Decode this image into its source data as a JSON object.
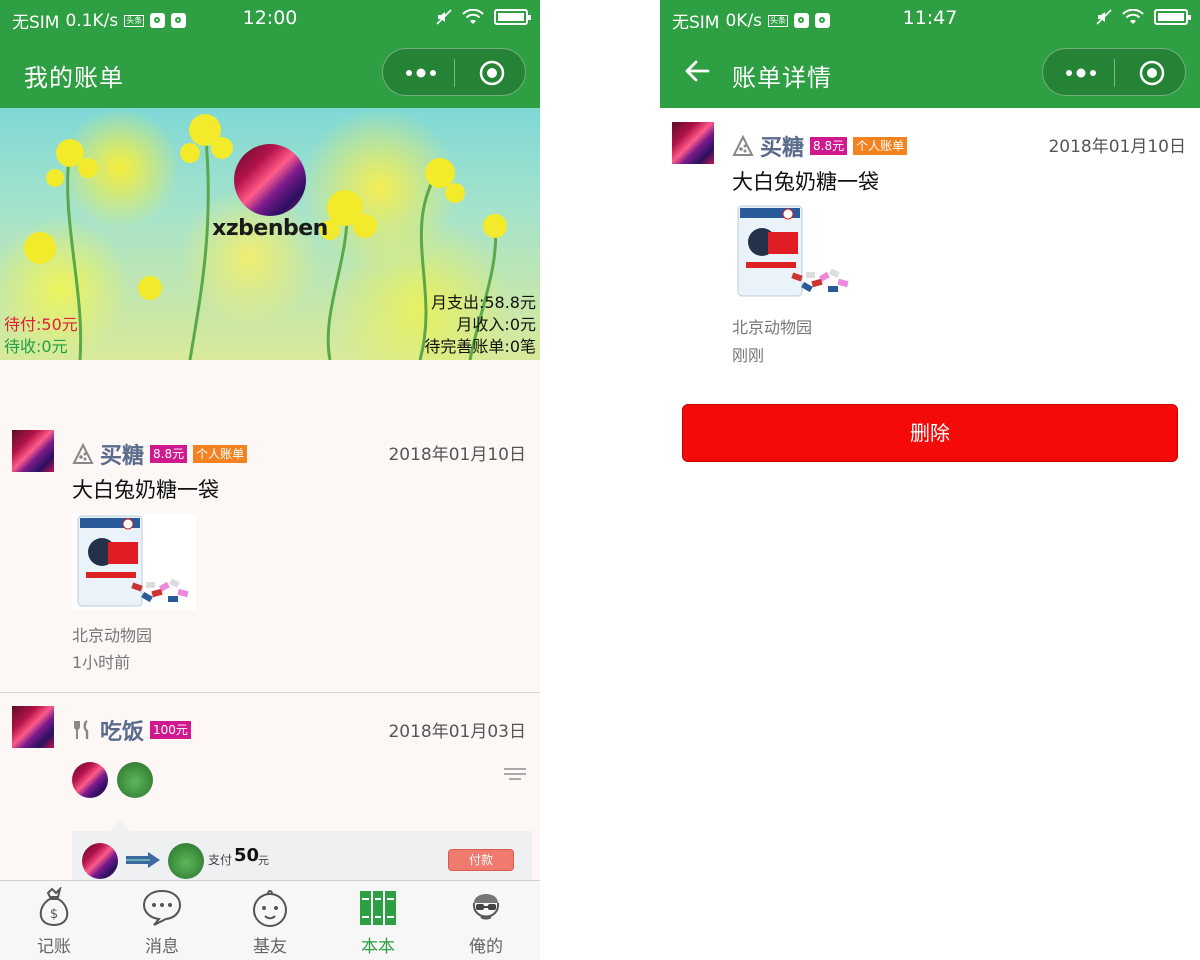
{
  "left": {
    "status": {
      "carrier": "无SIM",
      "speed": "0.1K/s",
      "mini_badge": "头条",
      "time": "12:00"
    },
    "nav": {
      "title": "我的账单"
    },
    "banner": {
      "username": "xzbenben",
      "pending_pay": "待付:50元",
      "pending_receive": "待收:0元",
      "monthly_expense": "月支出:58.8元",
      "monthly_income": "月收入:0元",
      "incomplete_bills": "待完善账单:0笔"
    },
    "bills": [
      {
        "category_icon": "pizza-slice-icon",
        "category": "买糖",
        "amount_tag": "8.8元",
        "type_tag": "个人账单",
        "date": "2018年01月10日",
        "description": "大白兔奶糖一袋",
        "location": "北京动物园",
        "time_ago": "1小时前"
      },
      {
        "category_icon": "fork-knife-icon",
        "category": "吃饭",
        "amount_tag": "100元",
        "date": "2018年01月03日",
        "payment": {
          "label": "支付",
          "amount": "50",
          "unit": "元",
          "button": "付款"
        }
      }
    ],
    "tabs": [
      {
        "label": "记账",
        "icon": "money-bag-icon",
        "active": false
      },
      {
        "label": "消息",
        "icon": "chat-bubble-icon",
        "active": false
      },
      {
        "label": "基友",
        "icon": "baby-face-icon",
        "active": false
      },
      {
        "label": "本本",
        "icon": "books-icon",
        "active": true
      },
      {
        "label": "俺的",
        "icon": "person-glasses-icon",
        "active": false
      }
    ]
  },
  "right": {
    "status": {
      "carrier": "无SIM",
      "speed": "0K/s",
      "mini_badge": "头条",
      "time": "11:47"
    },
    "nav": {
      "title": "账单详情"
    },
    "bill": {
      "category_icon": "pizza-slice-icon",
      "category": "买糖",
      "amount_tag": "8.8元",
      "type_tag": "个人账单",
      "date": "2018年01月10日",
      "description": "大白兔奶糖一袋",
      "location": "北京动物园",
      "time_ago": "刚刚"
    },
    "delete_button": "删除"
  },
  "colors": {
    "brand_green": "#2ea043",
    "amount_tag": "#d0198f",
    "type_tag": "#f58220",
    "delete_red": "#f50a0a",
    "pending_pay": "#e0203a",
    "pending_receive": "#20a045"
  }
}
